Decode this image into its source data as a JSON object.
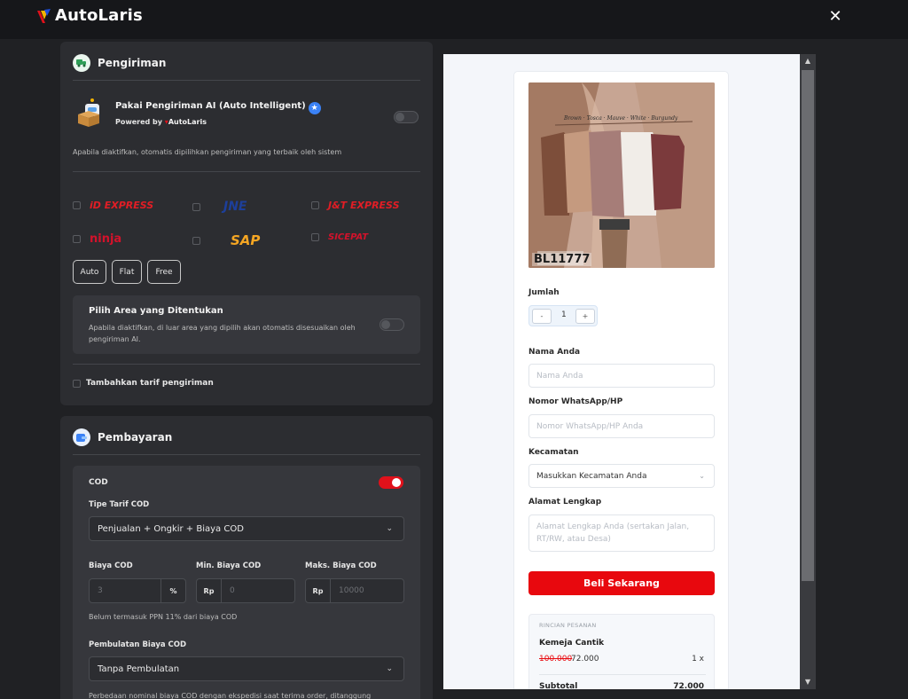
{
  "app": {
    "name": "AutoLaris"
  },
  "shipping": {
    "title": "Pengiriman",
    "ai_title": "Pakai Pengiriman AI (Auto Intelligent)",
    "powered_by": "Powered by",
    "powered_brand": "AutoLaris",
    "ai_enabled": false,
    "ai_desc": "Apabila diaktifkan, otomatis dipilihkan pengiriman yang terbaik oleh sistem",
    "couriers": [
      {
        "name": "iD EXPRESS",
        "color": "#e11d25"
      },
      {
        "name": "JNE",
        "color": "#1d3f9a"
      },
      {
        "name": "J&T EXPRESS",
        "color": "#e11d25"
      },
      {
        "name": "ninja",
        "color": "#d3122b"
      },
      {
        "name": "SAP",
        "color": "#f5a623"
      },
      {
        "name": "SICEPAT",
        "color": "#d3122b"
      }
    ],
    "modes": [
      "Auto",
      "Flat",
      "Free"
    ],
    "area_title": "Pilih Area yang Ditentukan",
    "area_desc": "Apabila diaktifkan, di luar area yang dipilih akan otomatis disesuaikan oleh pengiriman AI.",
    "area_enabled": false,
    "extra_label": "Tambahkan tarif pengiriman"
  },
  "payment": {
    "title": "Pembayaran",
    "cod_label": "COD",
    "cod_enabled": true,
    "tariff_type_label": "Tipe Tarif COD",
    "tariff_type_value": "Penjualan + Ongkir + Biaya COD",
    "fee_label": "Biaya COD",
    "fee_placeholder": "3",
    "fee_unit": "%",
    "min_label": "Min. Biaya COD",
    "min_prefix": "Rp",
    "min_placeholder": "0",
    "max_label": "Maks. Biaya COD",
    "max_prefix": "Rp",
    "max_placeholder": "10000",
    "ppn_note": "Belum termasuk PPN 11% dari biaya COD",
    "rounding_label": "Pembulatan Biaya COD",
    "rounding_value": "Tanpa Pembulatan",
    "bottom_note": "Perbedaan nominal biaya COD dengan ekspedisi saat terima order, ditanggung"
  },
  "preview": {
    "sku": "BL11777",
    "qty_label": "Jumlah",
    "qty_minus": "-",
    "qty_value": "1",
    "qty_plus": "+",
    "name_label": "Nama Anda",
    "name_placeholder": "Nama Anda",
    "phone_label": "Nomor WhatsApp/HP",
    "phone_placeholder": "Nomor WhatsApp/HP Anda",
    "district_label": "Kecamatan",
    "district_value": "Masukkan Kecamatan Anda",
    "address_label": "Alamat Lengkap",
    "address_placeholder": "Alamat Lengkap Anda (sertakan Jalan, RT/RW, atau Desa)",
    "buy_label": "Beli Sekarang",
    "summary_title": "RINCIAN PESANAN",
    "item_name": "Kemeja Cantik",
    "old_price": "100.000",
    "new_price": "72.000",
    "item_qty": "1 x",
    "subtotal_label": "Subtotal",
    "subtotal_value": "72.000"
  },
  "colors": {
    "accent": "#e0111b",
    "brand_blue": "#3b82f6"
  }
}
